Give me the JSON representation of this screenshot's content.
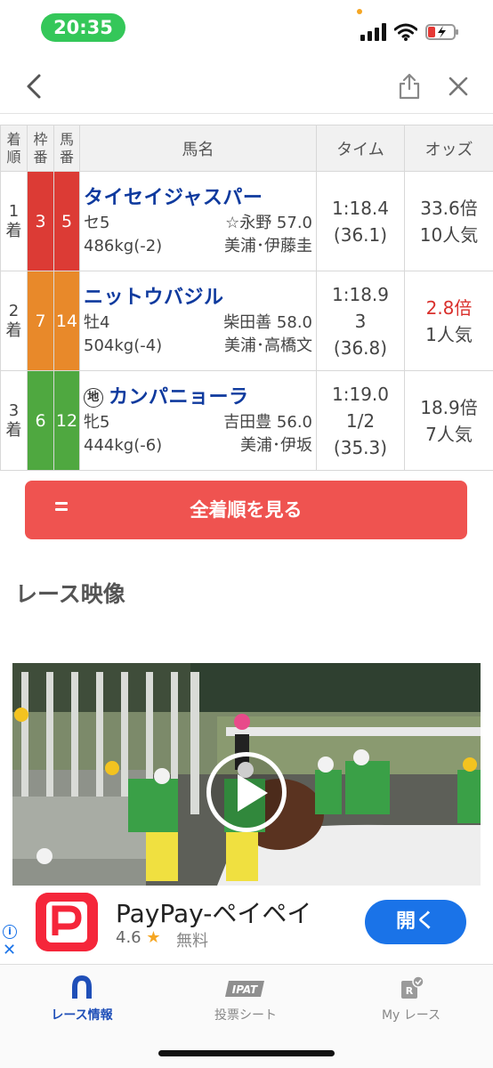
{
  "status_bar": {
    "time": "20:35"
  },
  "table": {
    "headers": {
      "rank": "着順",
      "waku": "枠番",
      "umaban": "馬番",
      "name": "馬名",
      "time": "タイム",
      "odds": "オッズ"
    },
    "rows": [
      {
        "rank": "1着",
        "waku": "3",
        "umaban": "5",
        "color": "#dc3b35",
        "chi": "",
        "name": "タイセイジャスパー",
        "sexage": "セ5",
        "jockey": "☆永野 57.0",
        "weight": "486kg(-2)",
        "trainer": "美浦･伊藤圭",
        "time": "1:18.4",
        "margin": "",
        "last3f": "(36.1)",
        "odds": "33.6倍",
        "popularity": "10人気",
        "favorite": false
      },
      {
        "rank": "2着",
        "waku": "7",
        "umaban": "14",
        "color": "#e8892a",
        "chi": "",
        "name": "ニットウバジル",
        "sexage": "牡4",
        "jockey": "柴田善 58.0",
        "weight": "504kg(-4)",
        "trainer": "美浦･高橋文",
        "time": "1:18.9",
        "margin": "3",
        "last3f": "(36.8)",
        "odds": "2.8倍",
        "popularity": "1人気",
        "favorite": true
      },
      {
        "rank": "3着",
        "waku": "6",
        "umaban": "12",
        "color": "#4fa840",
        "chi": "地",
        "name": "カンパニョーラ",
        "sexage": "牝5",
        "jockey": "吉田豊 56.0",
        "weight": "444kg(-6)",
        "trainer": "美浦･伊坂",
        "time": "1:19.0",
        "margin": "1/2",
        "last3f": "(35.3)",
        "odds": "18.9倍",
        "popularity": "7人気",
        "favorite": false
      }
    ]
  },
  "all_results_button": "全着順を見る",
  "video_section": {
    "title": "レース映像"
  },
  "ad": {
    "app_name": "PayPay-ペイペイ",
    "rating": "4.6",
    "price": "無料",
    "open_label": "開く"
  },
  "tabbar": {
    "items": [
      {
        "label": "レース情報",
        "icon": "horseshoe-icon"
      },
      {
        "label": "投票シート",
        "icon": "ipat-icon",
        "badge": "IPAT"
      },
      {
        "label": "My レース",
        "icon": "my-race-icon"
      }
    ]
  }
}
